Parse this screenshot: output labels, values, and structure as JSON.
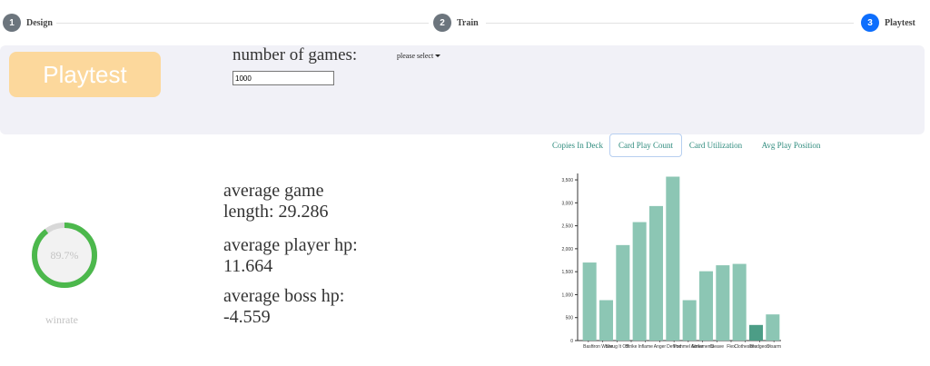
{
  "stepper": {
    "steps": [
      {
        "number": "1",
        "label": "Design"
      },
      {
        "number": "2",
        "label": "Train"
      },
      {
        "number": "3",
        "label": "Playtest",
        "active": true
      }
    ]
  },
  "controls": {
    "playtest_button": "Playtest",
    "games_label": "number of games:",
    "games_value": "1000",
    "dropdown_label": "please select"
  },
  "colors": {
    "accent": "#0d6efd",
    "button": "#fcd89c",
    "band": "#f1f1f7",
    "bar": "#8cc6b4",
    "bar_dark": "#4c9d86",
    "donut": "#4cb84c",
    "donut_track": "#d8d8d8"
  },
  "tabs": [
    {
      "label": "Copies In Deck"
    },
    {
      "label": "Card Play Count",
      "active": true
    },
    {
      "label": "Card Utilization"
    },
    {
      "label": "Avg Play Position"
    }
  ],
  "winrate": {
    "value": 0.897,
    "text": "89.7%",
    "label": "winrate"
  },
  "stats": {
    "game_length_label": "average game",
    "game_length_value": "length: 29.286",
    "player_hp_label": "average player hp:",
    "player_hp_value": "11.664",
    "boss_hp_label": "average boss hp:",
    "boss_hp_value": "-4.559"
  },
  "chart_data": {
    "type": "bar",
    "categories": [
      "Bash",
      "Iron Wave",
      "Shrug It Off",
      "Strike",
      "Inflame",
      "Anger",
      "Defend",
      "Pommel Strike",
      "Armaments",
      "Cleave",
      "Flex",
      "Clothesline",
      "Bludgeon",
      "Disarm"
    ],
    "values": [
      1700,
      880,
      2080,
      2580,
      2930,
      3570,
      880,
      1510,
      1640,
      1670,
      340,
      570
    ],
    "bar_count": 12,
    "yticks": [
      0,
      500,
      1000,
      1500,
      2000,
      2500,
      3000,
      3500
    ],
    "ytick_labels": [
      "0",
      "500",
      "1,000",
      "1,500",
      "2,000",
      "2,500",
      "3,000",
      "3,500"
    ],
    "ylim": [
      0,
      3600
    ],
    "xlabel": "",
    "ylabel": ""
  }
}
